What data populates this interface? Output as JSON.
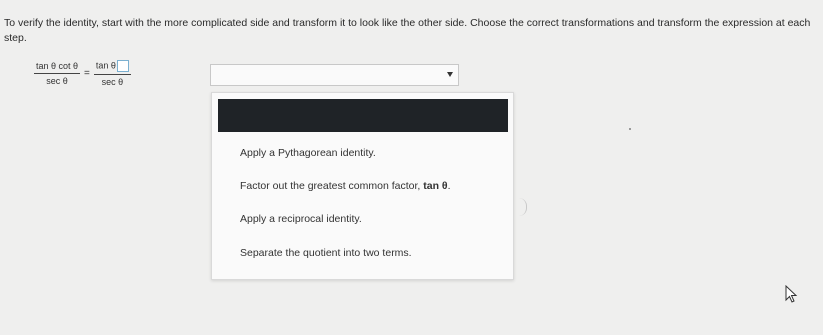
{
  "instructions": "To verify the identity, start with the more complicated side and transform it to look like the other side. Choose the correct transformations and transform the expression at each step.",
  "equation": {
    "left_numerator": "tan θ cot θ",
    "left_denominator": "sec θ",
    "equals": "=",
    "right_numerator": "tan θ",
    "right_denominator": "sec θ"
  },
  "select": {
    "value": ""
  },
  "dropdown": {
    "highlighted_option": "",
    "options": [
      {
        "text": "Apply a Pythagorean identity."
      },
      {
        "text": "Factor out the greatest common factor, ",
        "bold": "tan θ",
        "end": "."
      },
      {
        "text": "Apply a reciprocal identity."
      },
      {
        "text": "Separate the quotient into two terms."
      }
    ]
  },
  "icons": {
    "cursor": "mouse-pointer-icon",
    "select_arrow": "dropdown-arrow-icon"
  }
}
